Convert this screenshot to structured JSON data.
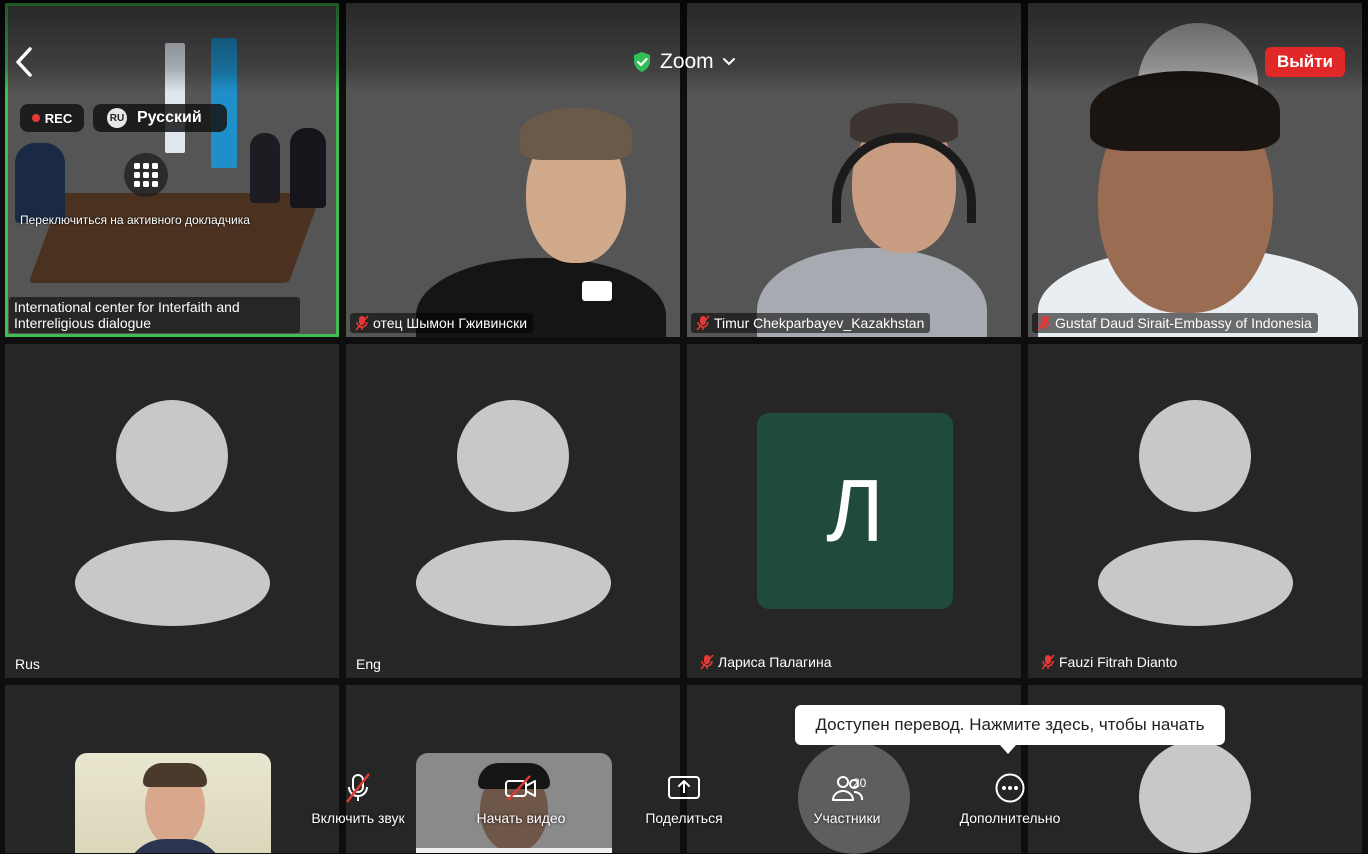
{
  "header": {
    "app_title": "Zoom",
    "leave_label": "Выйти",
    "rec_label": "REC",
    "language": {
      "code": "RU",
      "label": "Русский"
    },
    "switch_speaker_label": "Переключиться на активного докладчика"
  },
  "tiles": [
    {
      "name": "International center for Interfaith and Interreligious dialogue",
      "muted": false
    },
    {
      "name": "отец Шымон Гживински",
      "muted": true
    },
    {
      "name": "Timur Chekparbayev_Kazakhstan",
      "muted": true
    },
    {
      "name": "Gustaf Daud Sirait-Embassy of Indonesia",
      "muted": true
    },
    {
      "name": "Rus",
      "muted": false
    },
    {
      "name": "Eng",
      "muted": false
    },
    {
      "name": "Лариса Палагина",
      "muted": true,
      "initial": "Л"
    },
    {
      "name": "Fauzi Fitrah Dianto",
      "muted": true
    }
  ],
  "tooltip": "Доступен перевод. Нажмите здесь, чтобы начать",
  "toolbar": {
    "unmute_label": "Включить звук",
    "video_label": "Начать видео",
    "share_label": "Поделиться",
    "participants_label": "Участники",
    "participants_count": "20",
    "more_label": "Дополнительно"
  },
  "colors": {
    "active_border": "#3fbf52",
    "leave_button": "#e02828",
    "mute_icon": "#e53935",
    "initial_avatar": "#1f4a3d"
  }
}
